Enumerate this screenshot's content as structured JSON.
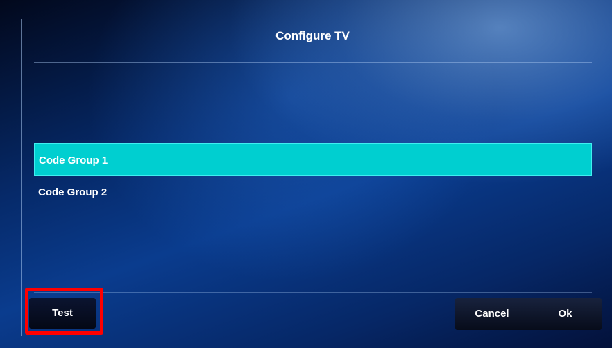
{
  "dialog": {
    "title": "Configure TV"
  },
  "code_groups": {
    "items": [
      {
        "label": "Code Group 1",
        "selected": true
      },
      {
        "label": "Code Group 2",
        "selected": false
      }
    ]
  },
  "buttons": {
    "test_label": "Test",
    "cancel_label": "Cancel",
    "ok_label": "Ok"
  },
  "colors": {
    "selected_item": "#00cfd0",
    "highlight_box": "#ff0000"
  }
}
